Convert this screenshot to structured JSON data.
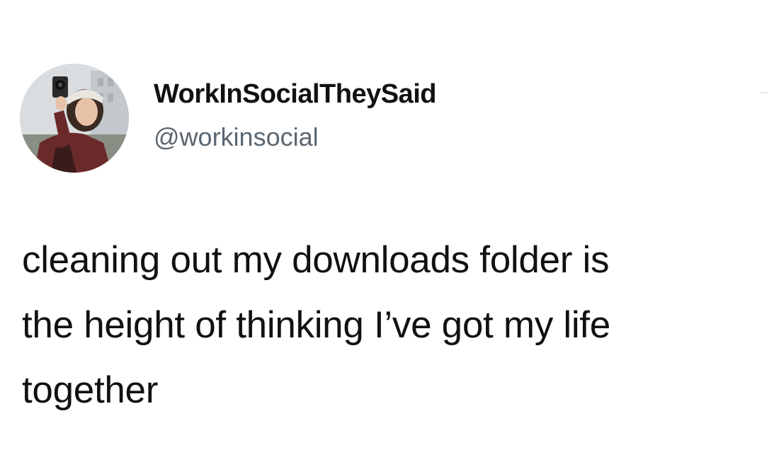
{
  "author": {
    "display_name": "WorkInSocialTheySaid",
    "handle": "@workinsocial",
    "avatar_icon": "profile-photo-icon"
  },
  "tweet": {
    "lines": [
      "cleaning out my downloads folder is",
      "the height of thinking I’ve got my life",
      "together"
    ]
  },
  "colors": {
    "background": "#ffffff",
    "text": "#111111",
    "handle": "#5b6670"
  }
}
